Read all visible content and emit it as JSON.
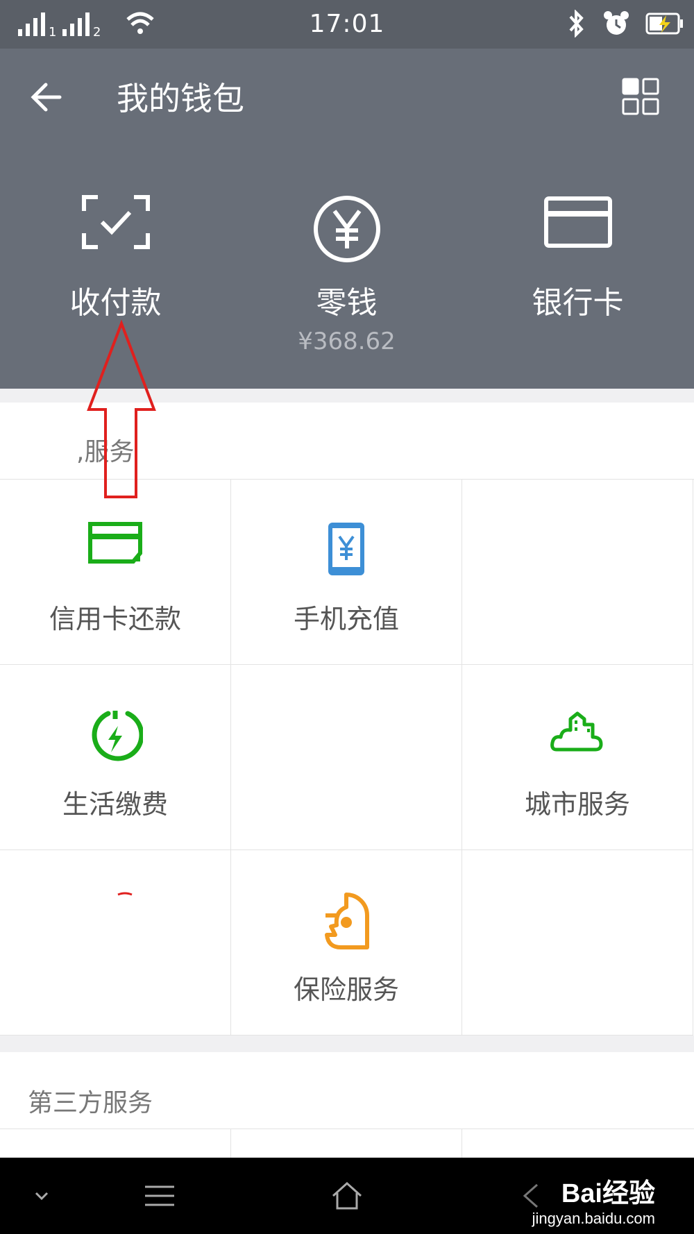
{
  "status_bar": {
    "time": "17:01",
    "sim1": "1",
    "sim2": "2",
    "icons": [
      "signal-icon",
      "wifi-icon",
      "bluetooth-icon",
      "alarm-icon",
      "battery-charging-icon"
    ]
  },
  "header": {
    "title": "我的钱包",
    "actions": [
      {
        "label": "收付款",
        "icon": "scan-check-icon"
      },
      {
        "label": "零钱",
        "icon": "yen-circle-icon",
        "balance": "¥368.62"
      },
      {
        "label": "银行卡",
        "icon": "bank-card-icon"
      }
    ]
  },
  "services": {
    "title": ",服务",
    "items": [
      {
        "label": "信用卡还款",
        "icon": "credit-card-repay-icon",
        "color": "#1aad19"
      },
      {
        "label": "手机充值",
        "icon": "mobile-topup-icon",
        "color": "#3d8fd6"
      },
      {
        "label": "",
        "icon": ""
      },
      {
        "label": "生活缴费",
        "icon": "utility-bill-icon",
        "color": "#1aad19"
      },
      {
        "label": "",
        "icon": ""
      },
      {
        "label": "城市服务",
        "icon": "city-service-icon",
        "color": "#1aad19"
      },
      {
        "label": "",
        "icon": ""
      },
      {
        "label": "保险服务",
        "icon": "insurance-icon",
        "color": "#f29a1f"
      },
      {
        "label": "",
        "icon": ""
      }
    ]
  },
  "third_party": {
    "title": "第三方服务"
  },
  "watermark": {
    "brand": "Bai经验",
    "url": "jingyan.baidu.com"
  },
  "colors": {
    "header_bg": "#686e78",
    "annotation": "#e0201e"
  }
}
